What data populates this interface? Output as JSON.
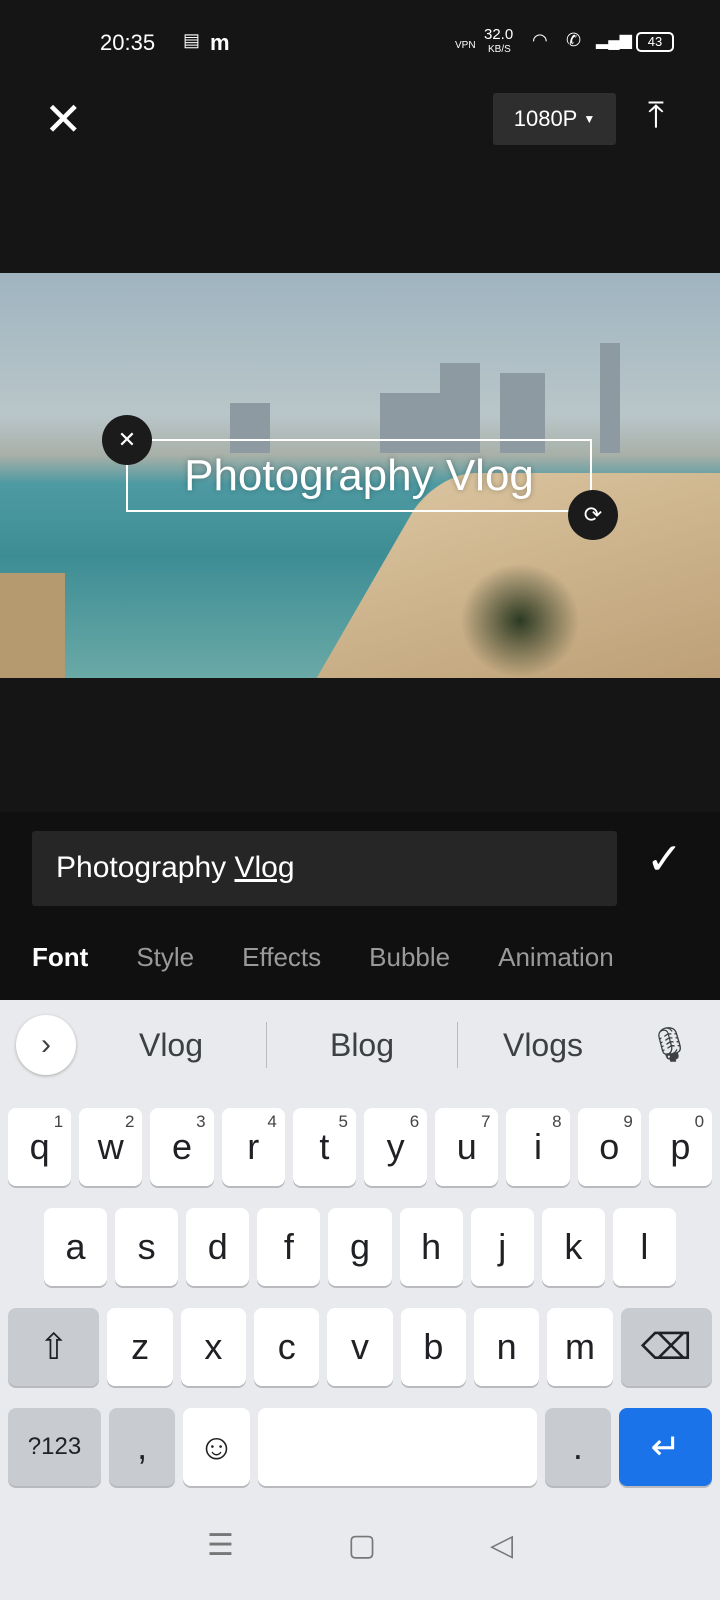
{
  "status": {
    "time": "20:35",
    "speed": "32.0",
    "speed_unit": "KB/S",
    "vpn": "VPN",
    "battery": "43"
  },
  "toolbar": {
    "resolution": "1080P"
  },
  "preview": {
    "text": "Photography Vlog"
  },
  "editor": {
    "input_value": "Photography ",
    "input_underlined": "Vlog",
    "tabs": [
      "Font",
      "Style",
      "Effects",
      "Bubble",
      "Animation"
    ]
  },
  "keyboard": {
    "suggestions": [
      "Vlog",
      "Blog",
      "Vlogs"
    ],
    "row1": [
      [
        "q",
        "1"
      ],
      [
        "w",
        "2"
      ],
      [
        "e",
        "3"
      ],
      [
        "r",
        "4"
      ],
      [
        "t",
        "5"
      ],
      [
        "y",
        "6"
      ],
      [
        "u",
        "7"
      ],
      [
        "i",
        "8"
      ],
      [
        "o",
        "9"
      ],
      [
        "p",
        "0"
      ]
    ],
    "row2": [
      "a",
      "s",
      "d",
      "f",
      "g",
      "h",
      "j",
      "k",
      "l"
    ],
    "row3": [
      "z",
      "x",
      "c",
      "v",
      "b",
      "n",
      "m"
    ],
    "symbols": "?123",
    "comma": ",",
    "period": "."
  },
  "colors": {
    "accent": "#1a73e8"
  }
}
